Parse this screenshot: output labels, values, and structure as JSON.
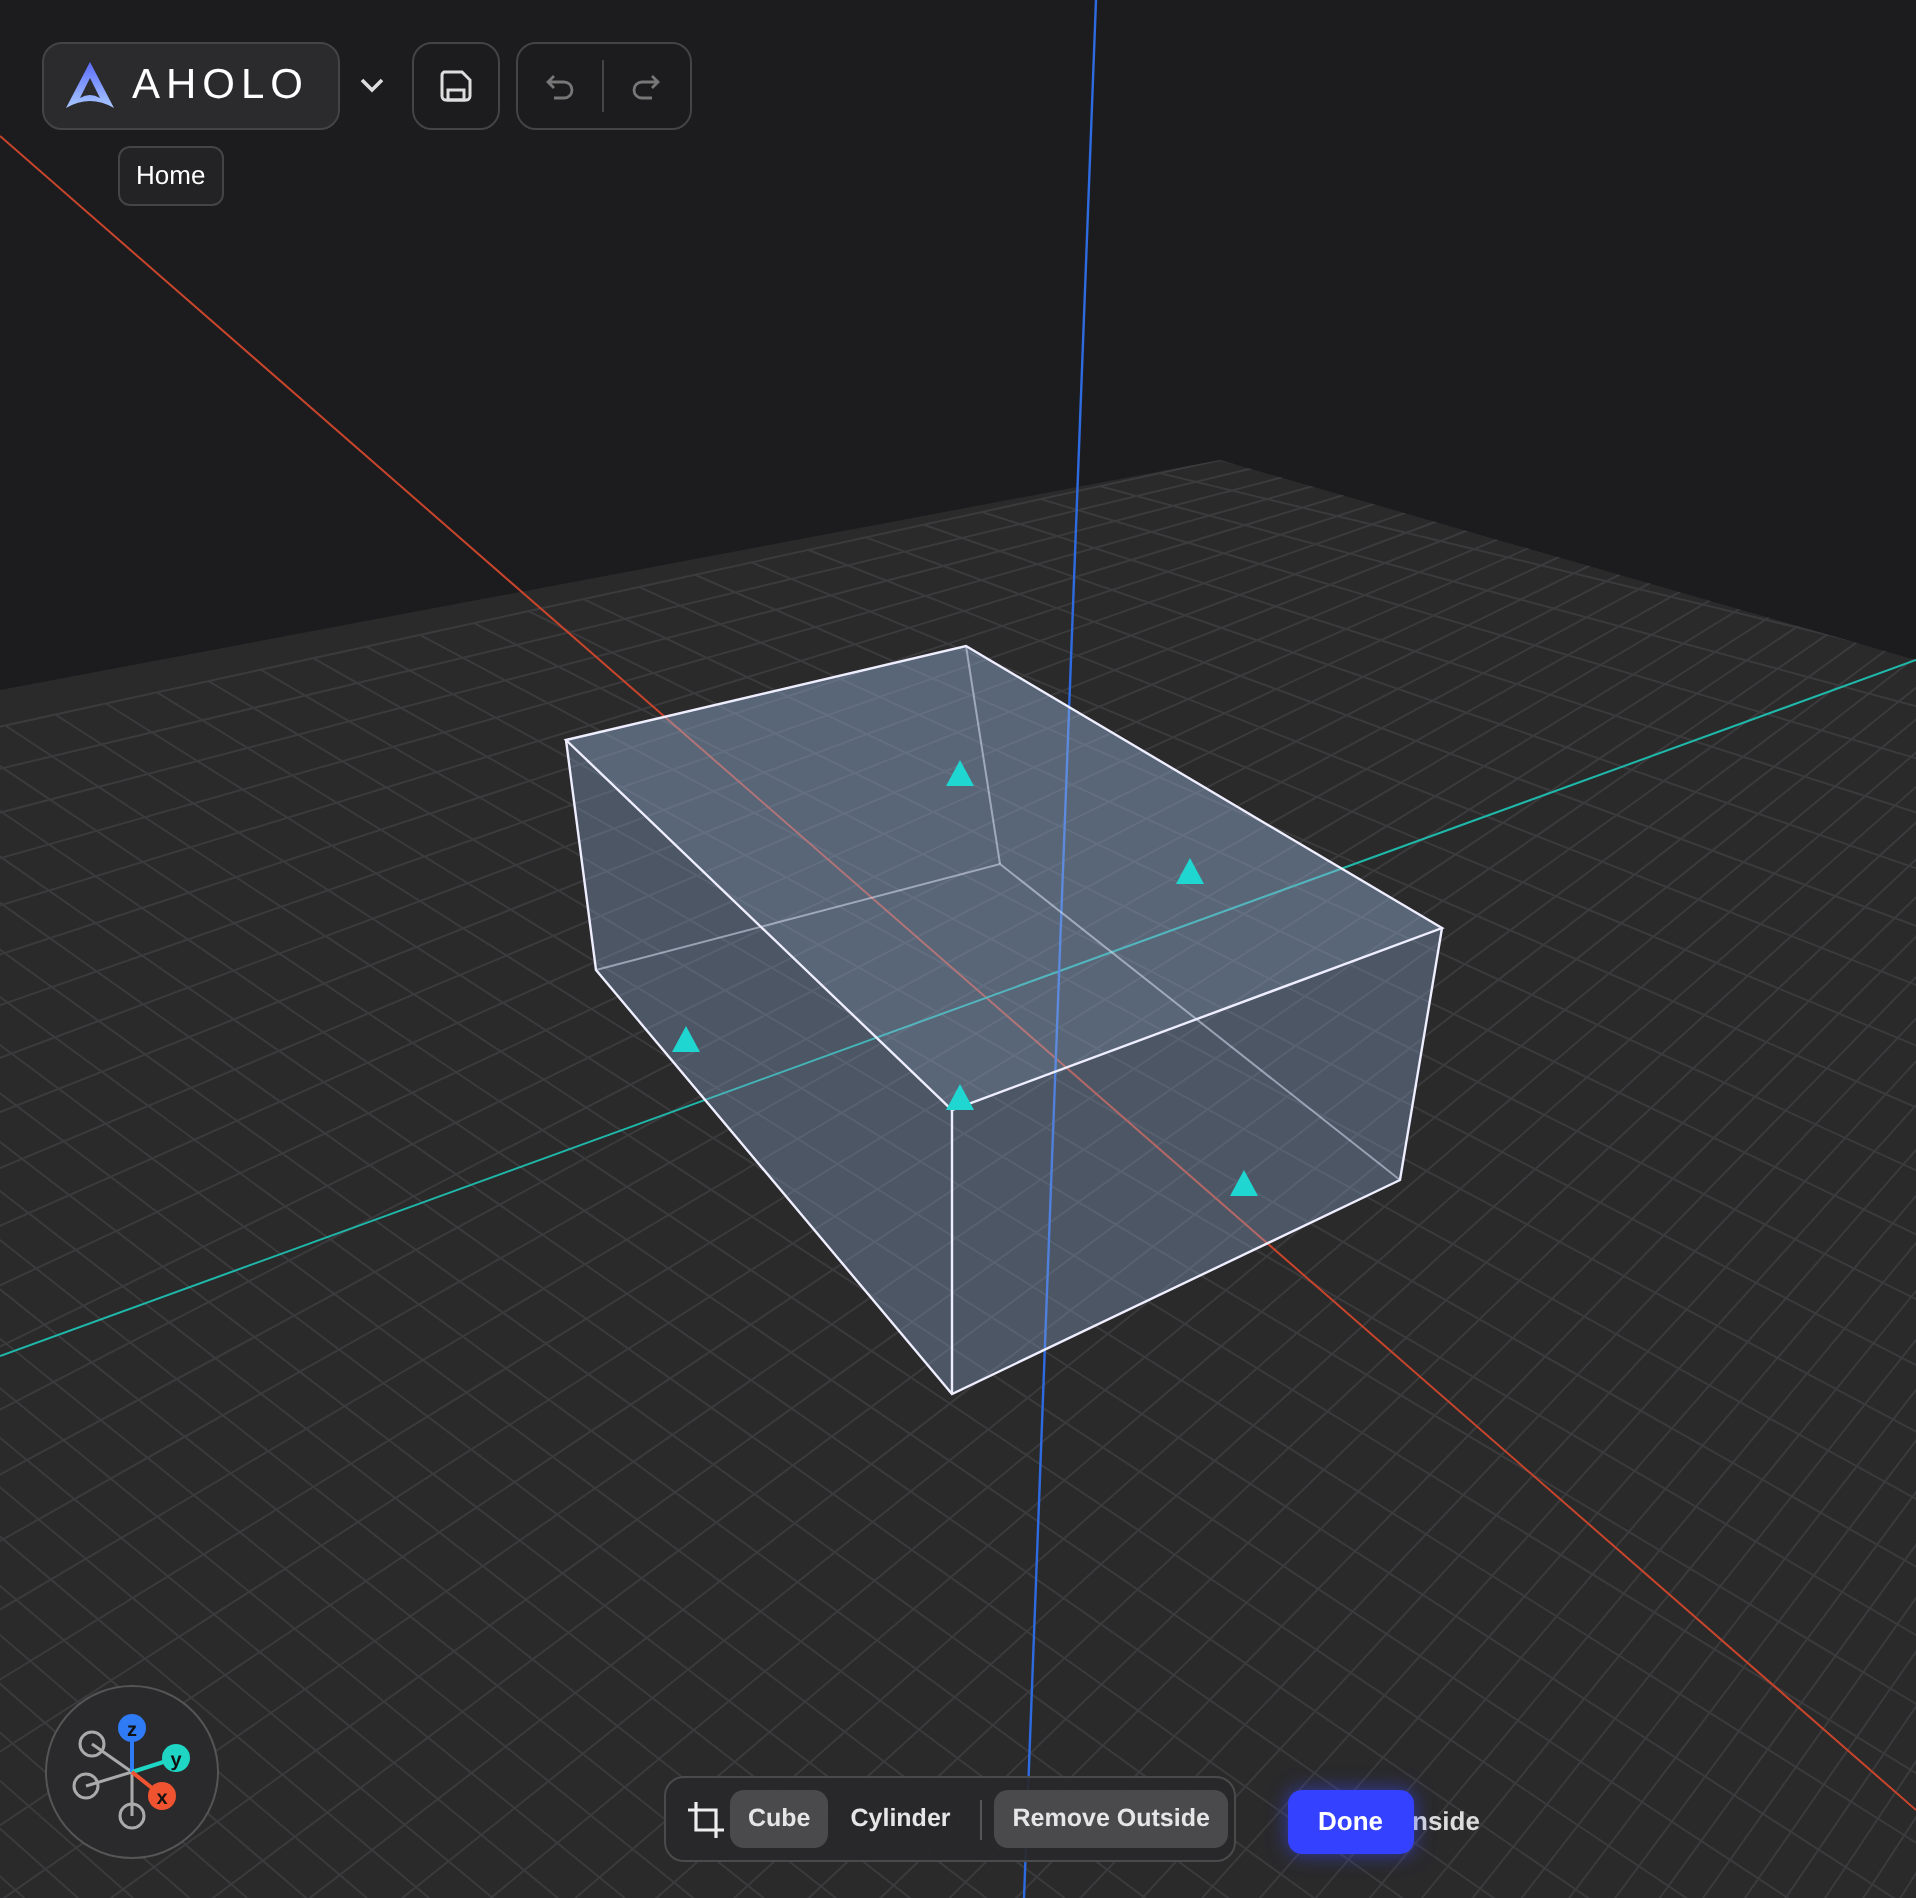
{
  "logo": {
    "text": "AHOLO"
  },
  "tooltip": "Home",
  "crop_tool": {
    "shapes": [
      {
        "label": "Cube",
        "selected": true
      },
      {
        "label": "Cylinder",
        "selected": false
      }
    ],
    "modes": [
      {
        "label": "Remove Outside",
        "selected": true
      }
    ],
    "done": "Done",
    "cut_text": "nside"
  },
  "gizmo": {
    "axes": [
      {
        "label": "z",
        "color": "#2f7bf5"
      },
      {
        "label": "y",
        "color": "#1fd6c4"
      },
      {
        "label": "x",
        "color": "#f0532f"
      }
    ]
  }
}
